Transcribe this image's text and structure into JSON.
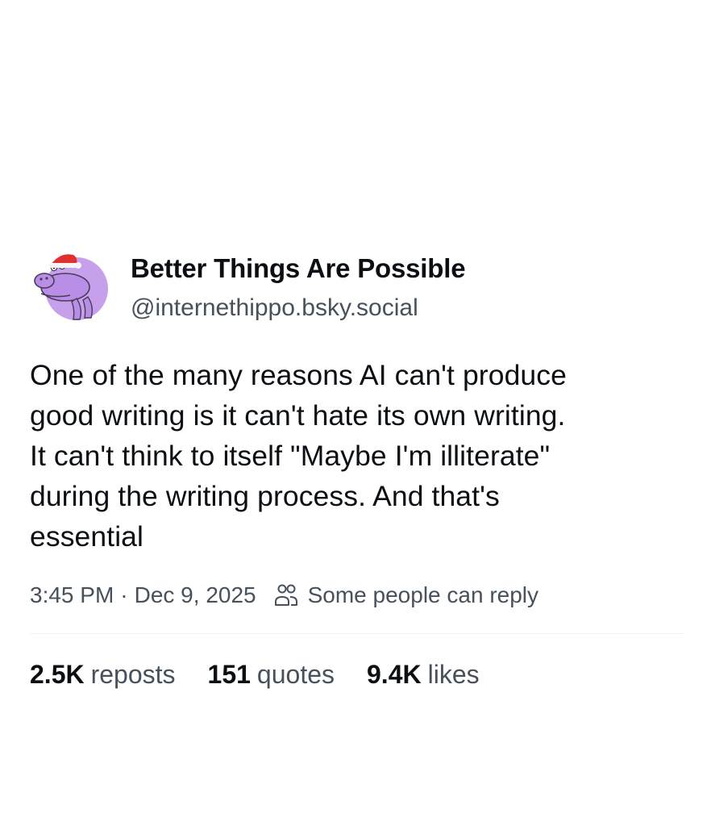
{
  "author": {
    "display_name": "Better Things Are Possible",
    "handle": "@internethippo.bsky.social",
    "avatar_icon": "purple-hippo-santa-hat-icon",
    "avatar_color": "#c9a3ee"
  },
  "post": {
    "lines": [
      "One of the many reasons AI can't produce",
      "good writing is it can't hate its own writing.",
      "It can't think to itself \"Maybe I'm illiterate\"",
      "during the writing process. And that's",
      "essential"
    ]
  },
  "meta": {
    "time": "3:45 PM",
    "separator": "·",
    "date": "Dec 9, 2025",
    "reply_icon": "people-icon",
    "reply_setting": "Some people can reply"
  },
  "stats": {
    "reposts_count": "2.5K",
    "reposts_label": "reposts",
    "quotes_count": "151",
    "quotes_label": "quotes",
    "likes_count": "9.4K",
    "likes_label": "likes"
  }
}
